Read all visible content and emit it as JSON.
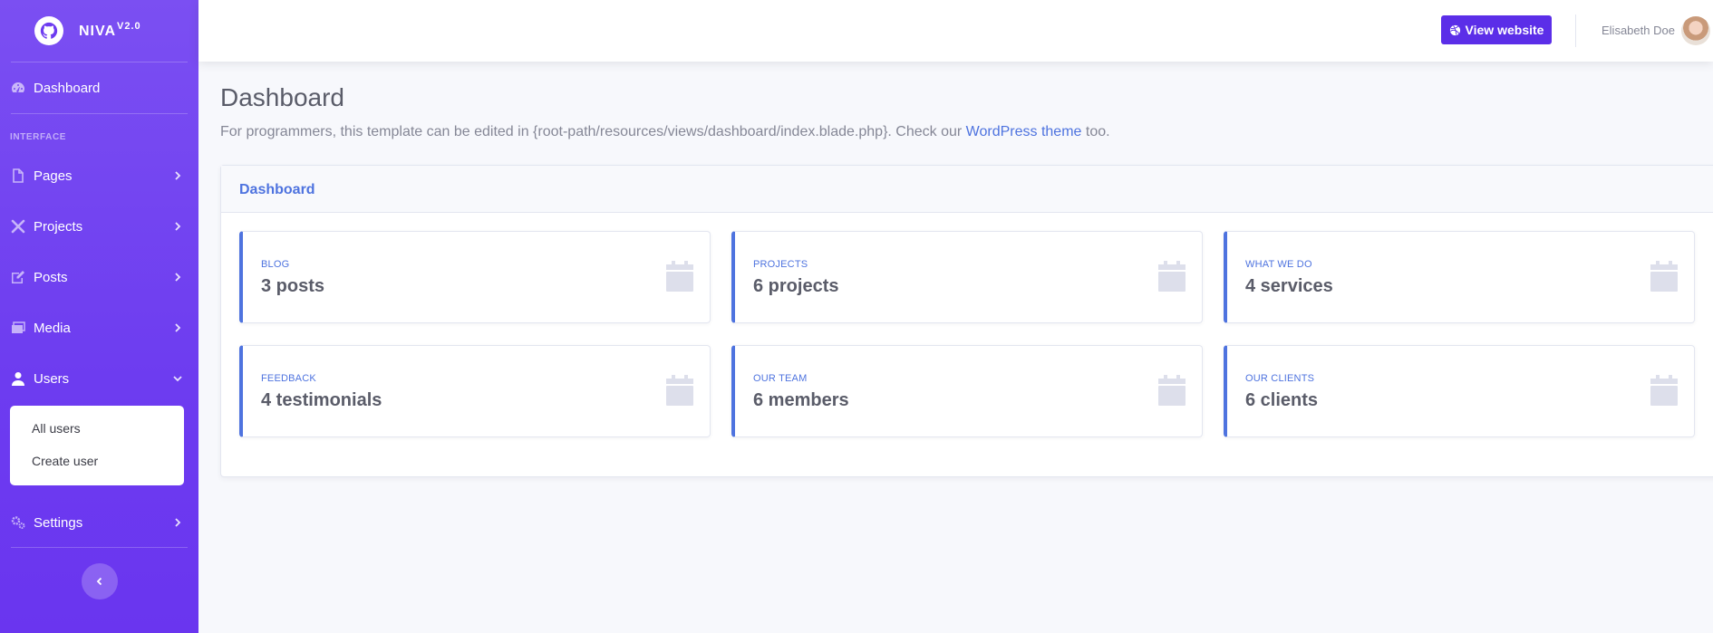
{
  "brand": {
    "name": "NIVA",
    "version": "V2.0",
    "logo_icon": "octocat-icon"
  },
  "sidebar": {
    "dashboard": {
      "label": "Dashboard",
      "icon": "tachometer-icon"
    },
    "heading": "INTERFACE",
    "items": [
      {
        "label": "Pages",
        "icon": "file-icon"
      },
      {
        "label": "Projects",
        "icon": "tools-icon"
      },
      {
        "label": "Posts",
        "icon": "edit-icon"
      },
      {
        "label": "Media",
        "icon": "images-icon"
      },
      {
        "label": "Users",
        "icon": "user-icon"
      },
      {
        "label": "Settings",
        "icon": "cogs-icon"
      }
    ],
    "users_submenu": [
      "All users",
      "Create user"
    ]
  },
  "topbar": {
    "view_website": "View website",
    "user_name": "Elisabeth Doe"
  },
  "page": {
    "title": "Dashboard",
    "desc_prefix": "For programmers, this template can be edited in {root-path/resources/views/dashboard/index.blade.php}. Check our ",
    "desc_link": "WordPress theme",
    "desc_suffix": " too."
  },
  "card": {
    "header": "Dashboard",
    "stats": [
      {
        "label": "BLOG",
        "value": "3 posts"
      },
      {
        "label": "PROJECTS",
        "value": "6 projects"
      },
      {
        "label": "WHAT WE DO",
        "value": "4 services"
      },
      {
        "label": "FEEDBACK",
        "value": "4 testimonials"
      },
      {
        "label": "OUR TEAM",
        "value": "6 members"
      },
      {
        "label": "OUR CLIENTS",
        "value": "6 clients"
      }
    ]
  },
  "colors": {
    "sidebar": "#6d3cf0",
    "primary": "#4e73df",
    "button": "#5b2ee8"
  }
}
